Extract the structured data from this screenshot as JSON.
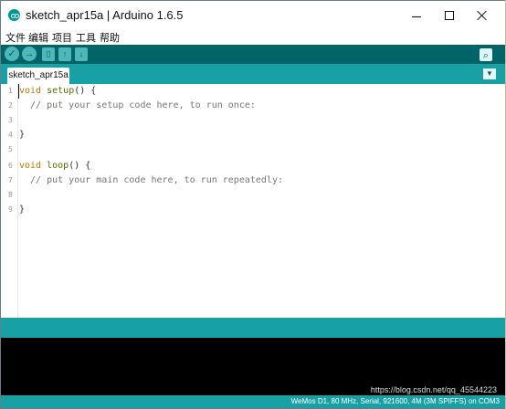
{
  "window": {
    "title": "sketch_apr15a | Arduino 1.6.5"
  },
  "menus": [
    "文件",
    "编辑",
    "项目",
    "工具",
    "帮助"
  ],
  "toolbar": {
    "buttons": [
      {
        "name": "verify",
        "icon": "check-icon"
      },
      {
        "name": "upload",
        "icon": "arrow-right-icon"
      },
      {
        "name": "new",
        "icon": "new-file-icon"
      },
      {
        "name": "open",
        "icon": "arrow-up-icon"
      },
      {
        "name": "save",
        "icon": "arrow-down-icon"
      }
    ],
    "serial_icon": "magnifier-icon"
  },
  "tabs": [
    {
      "label": "sketch_apr15a"
    }
  ],
  "editor": {
    "line_numbers": [
      "1",
      "2",
      "3",
      "4",
      "5",
      "6",
      "7",
      "8",
      "9"
    ],
    "lines": [
      {
        "kw": "void",
        "fn": "setup",
        "rest": "() {"
      },
      {
        "comment": "  // put your setup code here, to run once:"
      },
      {
        "plain": ""
      },
      {
        "plain": "}"
      },
      {
        "plain": ""
      },
      {
        "kw": "void",
        "fn": "loop",
        "rest": "() {"
      },
      {
        "comment": "  // put your main code here, to run repeatedly:"
      },
      {
        "plain": ""
      },
      {
        "plain": "}"
      }
    ]
  },
  "status": {
    "board": "WeMos D1, 80 MHz, Serial, 921600, 4M (3M SPIFFS) on COM3"
  },
  "watermark": "https://blog.csdn.net/qq_45544223",
  "colors": {
    "toolbar": "#006468",
    "tabs": "#17a1a5",
    "console": "#000000"
  }
}
